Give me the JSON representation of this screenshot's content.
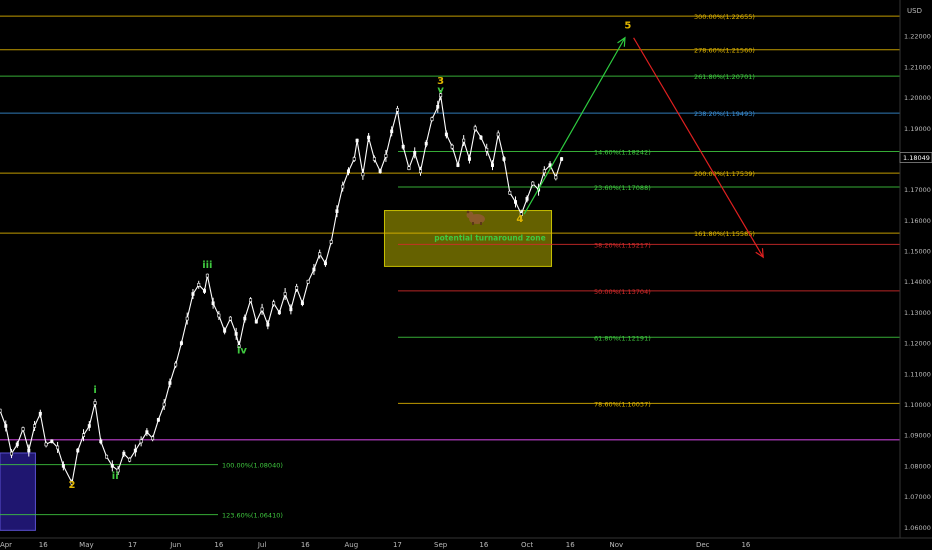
{
  "chart_data": {
    "type": "line",
    "currency_label": "USD",
    "last_price_label": "1.18049",
    "last_price": 1.18049,
    "ylim": [
      1.0565,
      1.2305
    ],
    "y_ticks": [
      "1.06000",
      "1.07000",
      "1.08000",
      "1.09000",
      "1.10000",
      "1.11000",
      "1.12000",
      "1.13000",
      "1.14000",
      "1.15000",
      "1.16000",
      "1.17000",
      "1.18000",
      "1.19000",
      "1.20000",
      "1.21000",
      "1.22000",
      "1.23000"
    ],
    "y_tick_values": [
      1.06,
      1.07,
      1.08,
      1.09,
      1.1,
      1.11,
      1.12,
      1.13,
      1.14,
      1.15,
      1.16,
      1.17,
      1.18,
      1.19,
      1.2,
      1.21,
      1.22,
      1.23
    ],
    "x_labels": [
      {
        "label": "Apr",
        "d": 0
      },
      {
        "label": "16",
        "d": 15
      },
      {
        "label": "May",
        "d": 30
      },
      {
        "label": "17",
        "d": 46
      },
      {
        "label": "Jun",
        "d": 61
      },
      {
        "label": "16",
        "d": 76
      },
      {
        "label": "Jul",
        "d": 91
      },
      {
        "label": "16",
        "d": 106
      },
      {
        "label": "Aug",
        "d": 122
      },
      {
        "label": "17",
        "d": 138
      },
      {
        "label": "Sep",
        "d": 153
      },
      {
        "label": "16",
        "d": 168
      },
      {
        "label": "Oct",
        "d": 183
      },
      {
        "label": "16",
        "d": 198
      },
      {
        "label": "Nov",
        "d": 214
      },
      {
        "label": "Dec",
        "d": 244
      },
      {
        "label": "16",
        "d": 259
      }
    ],
    "price_series": [
      {
        "d": 0,
        "v": 1.098
      },
      {
        "d": 2,
        "v": 1.093
      },
      {
        "d": 4,
        "v": 1.084
      },
      {
        "d": 6,
        "v": 1.087
      },
      {
        "d": 8,
        "v": 1.092
      },
      {
        "d": 10,
        "v": 1.085
      },
      {
        "d": 12,
        "v": 1.093
      },
      {
        "d": 14,
        "v": 1.097
      },
      {
        "d": 16,
        "v": 1.087
      },
      {
        "d": 18,
        "v": 1.088
      },
      {
        "d": 20,
        "v": 1.086
      },
      {
        "d": 22,
        "v": 1.08
      },
      {
        "d": 25,
        "v": 1.0745
      },
      {
        "d": 27,
        "v": 1.085
      },
      {
        "d": 29,
        "v": 1.09
      },
      {
        "d": 31,
        "v": 1.093
      },
      {
        "d": 33,
        "v": 1.1005
      },
      {
        "d": 35,
        "v": 1.088
      },
      {
        "d": 37,
        "v": 1.083
      },
      {
        "d": 39,
        "v": 1.08
      },
      {
        "d": 41,
        "v": 1.0785
      },
      {
        "d": 43,
        "v": 1.084
      },
      {
        "d": 45,
        "v": 1.082
      },
      {
        "d": 47,
        "v": 1.085
      },
      {
        "d": 49,
        "v": 1.088
      },
      {
        "d": 51,
        "v": 1.091
      },
      {
        "d": 53,
        "v": 1.089
      },
      {
        "d": 55,
        "v": 1.095
      },
      {
        "d": 57,
        "v": 1.1
      },
      {
        "d": 59,
        "v": 1.107
      },
      {
        "d": 61,
        "v": 1.113
      },
      {
        "d": 63,
        "v": 1.12
      },
      {
        "d": 65,
        "v": 1.128
      },
      {
        "d": 67,
        "v": 1.136
      },
      {
        "d": 69,
        "v": 1.139
      },
      {
        "d": 71,
        "v": 1.137
      },
      {
        "d": 72,
        "v": 1.142
      },
      {
        "d": 74,
        "v": 1.133
      },
      {
        "d": 76,
        "v": 1.129
      },
      {
        "d": 78,
        "v": 1.124
      },
      {
        "d": 80,
        "v": 1.128
      },
      {
        "d": 82,
        "v": 1.123
      },
      {
        "d": 83,
        "v": 1.119
      },
      {
        "d": 85,
        "v": 1.128
      },
      {
        "d": 87,
        "v": 1.134
      },
      {
        "d": 89,
        "v": 1.127
      },
      {
        "d": 91,
        "v": 1.131
      },
      {
        "d": 93,
        "v": 1.126
      },
      {
        "d": 95,
        "v": 1.133
      },
      {
        "d": 97,
        "v": 1.13
      },
      {
        "d": 99,
        "v": 1.136
      },
      {
        "d": 101,
        "v": 1.131
      },
      {
        "d": 103,
        "v": 1.138
      },
      {
        "d": 105,
        "v": 1.133
      },
      {
        "d": 107,
        "v": 1.14
      },
      {
        "d": 109,
        "v": 1.144
      },
      {
        "d": 111,
        "v": 1.149
      },
      {
        "d": 113,
        "v": 1.146
      },
      {
        "d": 115,
        "v": 1.153
      },
      {
        "d": 117,
        "v": 1.163
      },
      {
        "d": 119,
        "v": 1.171
      },
      {
        "d": 121,
        "v": 1.176
      },
      {
        "d": 123,
        "v": 1.18
      },
      {
        "d": 124,
        "v": 1.186
      },
      {
        "d": 126,
        "v": 1.175
      },
      {
        "d": 128,
        "v": 1.187
      },
      {
        "d": 130,
        "v": 1.18
      },
      {
        "d": 132,
        "v": 1.176
      },
      {
        "d": 134,
        "v": 1.181
      },
      {
        "d": 136,
        "v": 1.189
      },
      {
        "d": 138,
        "v": 1.196
      },
      {
        "d": 140,
        "v": 1.184
      },
      {
        "d": 142,
        "v": 1.177
      },
      {
        "d": 144,
        "v": 1.182
      },
      {
        "d": 146,
        "v": 1.176
      },
      {
        "d": 148,
        "v": 1.185
      },
      {
        "d": 150,
        "v": 1.193
      },
      {
        "d": 152,
        "v": 1.197
      },
      {
        "d": 153,
        "v": 1.2008
      },
      {
        "d": 155,
        "v": 1.188
      },
      {
        "d": 157,
        "v": 1.184
      },
      {
        "d": 159,
        "v": 1.178
      },
      {
        "d": 161,
        "v": 1.186
      },
      {
        "d": 163,
        "v": 1.18
      },
      {
        "d": 165,
        "v": 1.19
      },
      {
        "d": 167,
        "v": 1.187
      },
      {
        "d": 169,
        "v": 1.183
      },
      {
        "d": 171,
        "v": 1.178
      },
      {
        "d": 173,
        "v": 1.188
      },
      {
        "d": 175,
        "v": 1.18
      },
      {
        "d": 177,
        "v": 1.169
      },
      {
        "d": 179,
        "v": 1.166
      },
      {
        "d": 181,
        "v": 1.162
      },
      {
        "d": 183,
        "v": 1.167
      },
      {
        "d": 185,
        "v": 1.172
      },
      {
        "d": 187,
        "v": 1.17
      },
      {
        "d": 189,
        "v": 1.176
      },
      {
        "d": 191,
        "v": 1.178
      },
      {
        "d": 193,
        "v": 1.174
      },
      {
        "d": 195,
        "v": 1.18
      }
    ],
    "fib_lines": [
      {
        "label": "300.00%(1.22655)",
        "value": 1.22655,
        "color": "#e0b500",
        "full": true
      },
      {
        "label": "278.60%(1.21560)",
        "value": 1.2156,
        "color": "#e0b500",
        "full": true
      },
      {
        "label": "261.80%(1.20701)",
        "value": 1.20701,
        "color": "#3fc93f",
        "full": true
      },
      {
        "label": "238.20%(1.19493)",
        "value": 1.19493,
        "color": "#3a8fd6",
        "full": true
      },
      {
        "label": "14.60%(1.18242)",
        "value": 1.18242,
        "color": "#3fc93f",
        "full": false
      },
      {
        "label": "200.00%(1.17539)",
        "value": 1.17539,
        "color": "#e0b500",
        "full": true
      },
      {
        "label": "23.60%(1.17088)",
        "value": 1.17088,
        "color": "#3fc93f",
        "full": false
      },
      {
        "label": "161.80%(1.15585)",
        "value": 1.15585,
        "color": "#e0b500",
        "full": true
      },
      {
        "label": "38.20%(1.15217)",
        "value": 1.15217,
        "color": "#d62b2b",
        "full": false
      },
      {
        "label": "50.00%(1.13704)",
        "value": 1.13704,
        "color": "#d62b2b",
        "full": false
      },
      {
        "label": "61.80%(1.12191)",
        "value": 1.12191,
        "color": "#3fc93f",
        "full": false
      },
      {
        "label": "78.60%(1.10037)",
        "value": 1.10037,
        "color": "#e0b500",
        "full": false
      }
    ],
    "lower_fib_lines": [
      {
        "label": "100.00%(1.08040)",
        "value": 1.0804,
        "color": "#3fc93f"
      },
      {
        "label": "123.60%(1.06410)",
        "value": 1.0641,
        "color": "#3fc93f"
      }
    ],
    "support_line_value": 1.0885,
    "support_line_color": "#c040d0",
    "wave_labels": [
      {
        "label": "2",
        "d": 25,
        "v": 1.0728,
        "color": "#e0b500"
      },
      {
        "label": "i",
        "d": 33,
        "v": 1.1038,
        "color": "#3fc93f"
      },
      {
        "label": "ii",
        "d": 40,
        "v": 1.0758,
        "color": "#3fc93f"
      },
      {
        "label": "iii",
        "d": 72,
        "v": 1.1445,
        "color": "#3fc93f"
      },
      {
        "label": "iv",
        "d": 84,
        "v": 1.1166,
        "color": "#3fc93f"
      },
      {
        "label": "3",
        "d": 153,
        "v": 1.2045,
        "color": "#e0b500"
      },
      {
        "label": "v",
        "d": 153,
        "v": 1.2015,
        "color": "#3fc93f"
      },
      {
        "label": "4",
        "d": 180.5,
        "v": 1.1595,
        "color": "#e0b500"
      },
      {
        "label": "5",
        "d": 218,
        "v": 1.2225,
        "color": "#e0b500"
      }
    ],
    "turnaround_zone": {
      "label": "potential turnaround zone",
      "d0": 133.5,
      "d1": 191.5,
      "v0": 1.145,
      "v1": 1.1632,
      "label_color": "#3fc93f"
    },
    "blue_box": {
      "d0": 0,
      "d1": 12.3,
      "v0": 1.059,
      "v1": 1.0842
    },
    "projection_up": {
      "d0": 182,
      "v0": 1.162,
      "d1": 217,
      "v1": 1.2195,
      "color": "#2ecc40"
    },
    "projection_down": {
      "d0": 220,
      "v0": 1.2195,
      "d1": 265,
      "v1": 1.148,
      "color": "#e02020"
    },
    "bear_icon": "bear-icon",
    "grid": false
  }
}
